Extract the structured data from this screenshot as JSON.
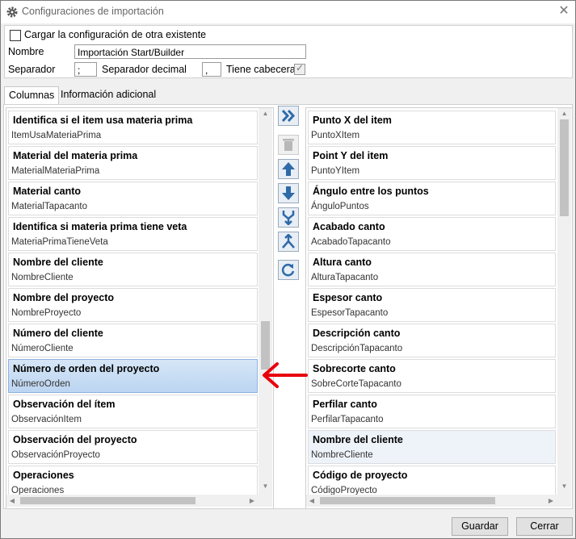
{
  "window": {
    "title": "Configuraciones de importación"
  },
  "top": {
    "load_existing_label": "Cargar la configuración de otra existente",
    "name_label": "Nombre",
    "name_value": "Importación Start/Builder",
    "separator_label": "Separador",
    "separator_value": ";",
    "decimal_label": "Separador decimal",
    "decimal_value": ",",
    "header_label": "Tiene cabecera"
  },
  "tabs": [
    "Columnas",
    "Información adicional"
  ],
  "left_list": [
    {
      "title": "Identifica si el item usa materia prima",
      "sub": "ItemUsaMateriaPrima"
    },
    {
      "title": "Material del materia prima",
      "sub": "MaterialMateriaPrima"
    },
    {
      "title": "Material canto",
      "sub": "MaterialTapacanto"
    },
    {
      "title": "Identifica si materia prima tiene veta",
      "sub": "MateriaPrimaTieneVeta"
    },
    {
      "title": "Nombre del cliente",
      "sub": "NombreCliente"
    },
    {
      "title": "Nombre del proyecto",
      "sub": "NombreProyecto"
    },
    {
      "title": "Número del cliente",
      "sub": "NúmeroCliente"
    },
    {
      "title": "Número de orden del proyecto",
      "sub": "NúmeroOrden"
    },
    {
      "title": "Observación del ítem",
      "sub": "ObservaciónItem"
    },
    {
      "title": "Observación del proyecto",
      "sub": "ObservaciónProyecto"
    },
    {
      "title": "Operaciones",
      "sub": "Operaciones"
    }
  ],
  "right_list": [
    {
      "title": "Punto X del item",
      "sub": "PuntoXItem"
    },
    {
      "title": "Point Y del item",
      "sub": "PuntoYItem"
    },
    {
      "title": "Ángulo entre los puntos",
      "sub": "ÁnguloPuntos"
    },
    {
      "title": "Acabado canto",
      "sub": "AcabadoTapacanto"
    },
    {
      "title": "Altura canto",
      "sub": "AlturaTapacanto"
    },
    {
      "title": "Espesor canto",
      "sub": "EspesorTapacanto"
    },
    {
      "title": "Descripción canto",
      "sub": "DescripciónTapacanto"
    },
    {
      "title": "Sobrecorte canto",
      "sub": "SobreCorteTapacanto"
    },
    {
      "title": "Perfilar canto",
      "sub": "PerfilarTapacanto"
    },
    {
      "title": "Nombre del cliente",
      "sub": "NombreCliente"
    },
    {
      "title": "Código de proyecto",
      "sub": "CódigoProyecto"
    }
  ],
  "toolbar": [
    "move-all-icon",
    "trash-icon",
    "arrow-up-icon",
    "arrow-down-icon",
    "merge-icon",
    "split-icon",
    "refresh-icon"
  ],
  "buttons": {
    "save": "Guardar",
    "close": "Cerrar"
  },
  "colors": {
    "selected": "#bcd5f1",
    "arrow": "#e8000d",
    "toolbar_icon": "#2e6aa8"
  }
}
